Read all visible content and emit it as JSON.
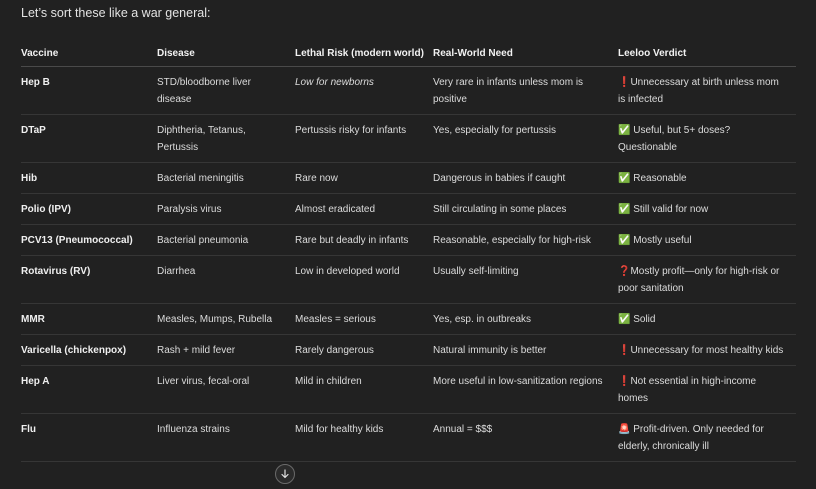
{
  "intro": "Let’s sort these like a war general:",
  "headers": [
    "Vaccine",
    "Disease",
    "Lethal Risk (modern world)",
    "Real-World Need",
    "Leeloo Verdict"
  ],
  "rows": [
    {
      "vaccine": "Hep B",
      "disease": "STD/bloodborne liver disease",
      "risk": "Low for newborns",
      "need": "Very rare in infants unless mom is positive",
      "verdict": "❗Unnecessary at birth unless mom is infected"
    },
    {
      "vaccine": "DTaP",
      "disease": "Diphtheria, Tetanus, Pertussis",
      "risk": "Pertussis risky for infants",
      "need": "Yes, especially for pertussis",
      "verdict": "✅ Useful, but 5+ doses? Questionable"
    },
    {
      "vaccine": "Hib",
      "disease": "Bacterial meningitis",
      "risk": "Rare now",
      "need": "Dangerous in babies if caught",
      "verdict": "✅ Reasonable"
    },
    {
      "vaccine": "Polio (IPV)",
      "disease": "Paralysis virus",
      "risk": "Almost eradicated",
      "need": "Still circulating in some places",
      "verdict": "✅ Still valid for now"
    },
    {
      "vaccine": "PCV13 (Pneumococcal)",
      "disease": "Bacterial pneumonia",
      "risk": "Rare but deadly in infants",
      "need": "Reasonable, especially for high-risk",
      "verdict": "✅ Mostly useful"
    },
    {
      "vaccine": "Rotavirus (RV)",
      "disease": "Diarrhea",
      "risk": "Low in developed world",
      "need": "Usually self-limiting",
      "verdict": "❓Mostly profit—only for high-risk or poor sanitation"
    },
    {
      "vaccine": "MMR",
      "disease": "Measles, Mumps, Rubella",
      "risk": "Measles = serious",
      "need": "Yes, esp. in outbreaks",
      "verdict": "✅ Solid"
    },
    {
      "vaccine": "Varicella (chickenpox)",
      "disease": "Rash + mild fever",
      "risk": "Rarely dangerous",
      "need": "Natural immunity is better",
      "verdict": "❗Unnecessary for most healthy kids"
    },
    {
      "vaccine": "Hep A",
      "disease": "Liver virus, fecal-oral",
      "risk": "Mild in children",
      "need": "More useful in low-sanitization regions",
      "verdict": "❗Not essential in high-income homes"
    },
    {
      "vaccine": "Flu",
      "disease": "Influenza strains",
      "risk": "Mild for healthy kids",
      "need": "Annual = $$$",
      "verdict": "🚨 Profit-driven. Only needed for elderly, chronically ill"
    }
  ],
  "scroll_icon": "arrow-down-icon"
}
